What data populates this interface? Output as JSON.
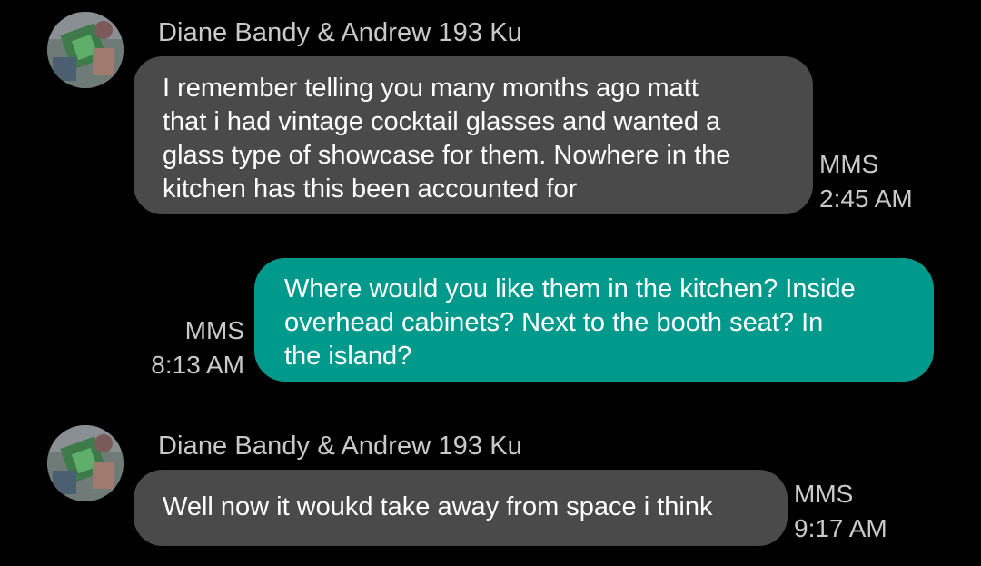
{
  "conversation": {
    "messages": [
      {
        "direction": "incoming",
        "sender": "Diane Bandy & Andrew 193 Ku",
        "lines": [
          "I remember telling you many months ago matt",
          "that i had vintage cocktail glasses and wanted a",
          "glass type of showcase for them. Nowhere in the",
          "kitchen has this been accounted for"
        ],
        "type": "MMS",
        "time": "2:45 AM"
      },
      {
        "direction": "outgoing",
        "lines": [
          "Where would you like them in the kitchen?  Inside",
          "overhead cabinets?  Next to the booth seat?  In",
          "the island?"
        ],
        "type": "MMS",
        "time": "8:13 AM"
      },
      {
        "direction": "incoming",
        "sender": "Diane Bandy & Andrew 193 Ku",
        "lines": [
          "Well now it woukd take away from space i think"
        ],
        "type": "MMS",
        "time": "9:17 AM"
      }
    ]
  },
  "colors": {
    "background": "#000000",
    "incoming_bubble": "#4a4a4a",
    "outgoing_bubble": "#009a8c",
    "meta_text": "#c9c9c9"
  },
  "icons": {
    "avatar": "contact-photo-avatar"
  }
}
